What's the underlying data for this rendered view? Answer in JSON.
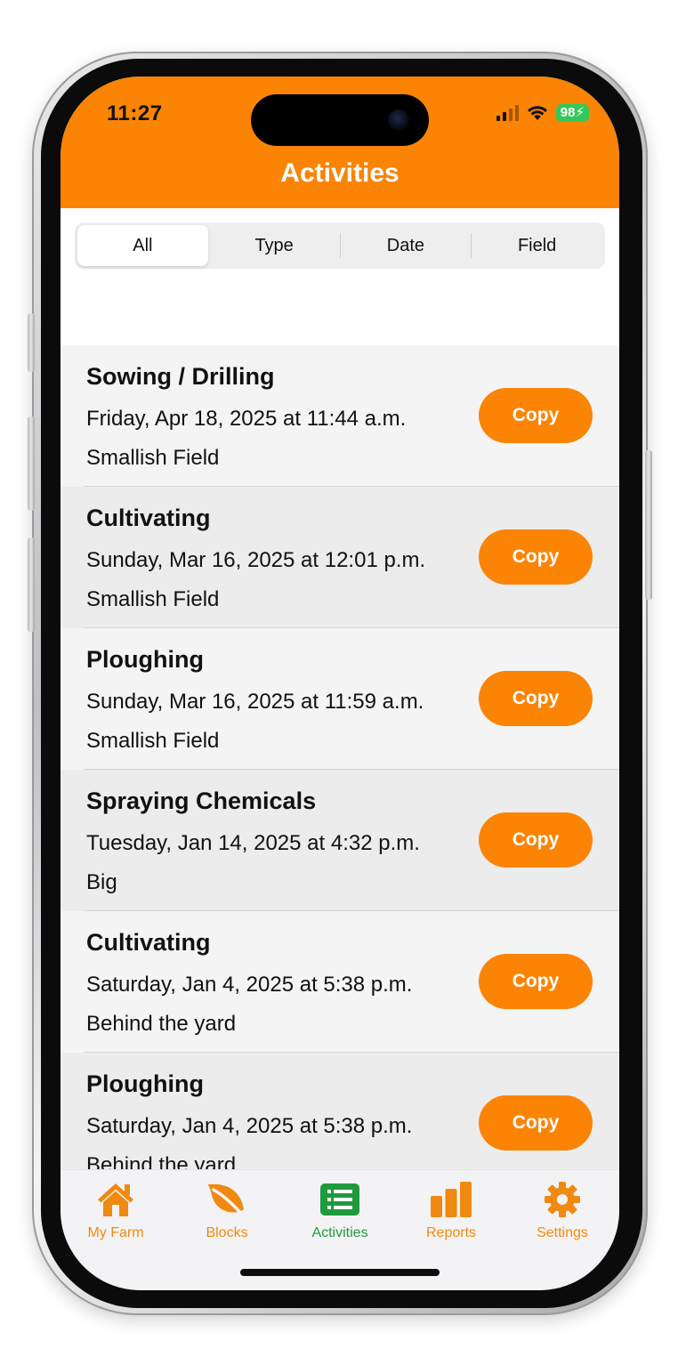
{
  "status_bar": {
    "time": "11:27",
    "battery": "98"
  },
  "header": {
    "title": "Activities"
  },
  "filters": [
    {
      "label": "All",
      "selected": true
    },
    {
      "label": "Type",
      "selected": false
    },
    {
      "label": "Date",
      "selected": false
    },
    {
      "label": "Field",
      "selected": false
    }
  ],
  "activities": [
    {
      "title": "Sowing / Drilling",
      "date": "Friday, Apr 18, 2025 at 11:44 a.m.",
      "field": "Smallish Field",
      "action": "Copy"
    },
    {
      "title": "Cultivating",
      "date": "Sunday, Mar 16, 2025 at 12:01 p.m.",
      "field": "Smallish Field",
      "action": "Copy"
    },
    {
      "title": "Ploughing",
      "date": "Sunday, Mar 16, 2025 at 11:59 a.m.",
      "field": "Smallish Field",
      "action": "Copy"
    },
    {
      "title": "Spraying Chemicals",
      "date": "Tuesday, Jan 14, 2025 at 4:32 p.m.",
      "field": "Big",
      "action": "Copy"
    },
    {
      "title": "Cultivating",
      "date": "Saturday, Jan 4, 2025 at 5:38 p.m.",
      "field": "Behind the yard",
      "action": "Copy"
    },
    {
      "title": "Ploughing",
      "date": "Saturday, Jan 4, 2025 at 5:38 p.m.",
      "field": "Behind the yard",
      "action": "Copy"
    }
  ],
  "tabbar": [
    {
      "label": "My Farm",
      "icon": "house-icon",
      "active": false
    },
    {
      "label": "Blocks",
      "icon": "leaf-icon",
      "active": false
    },
    {
      "label": "Activities",
      "icon": "list-icon",
      "active": true
    },
    {
      "label": "Reports",
      "icon": "bar-chart-icon",
      "active": false
    },
    {
      "label": "Settings",
      "icon": "gear-icon",
      "active": false
    }
  ],
  "colors": {
    "accent": "#fb8405",
    "active_tab": "#1f9a3e",
    "battery": "#34c759"
  }
}
